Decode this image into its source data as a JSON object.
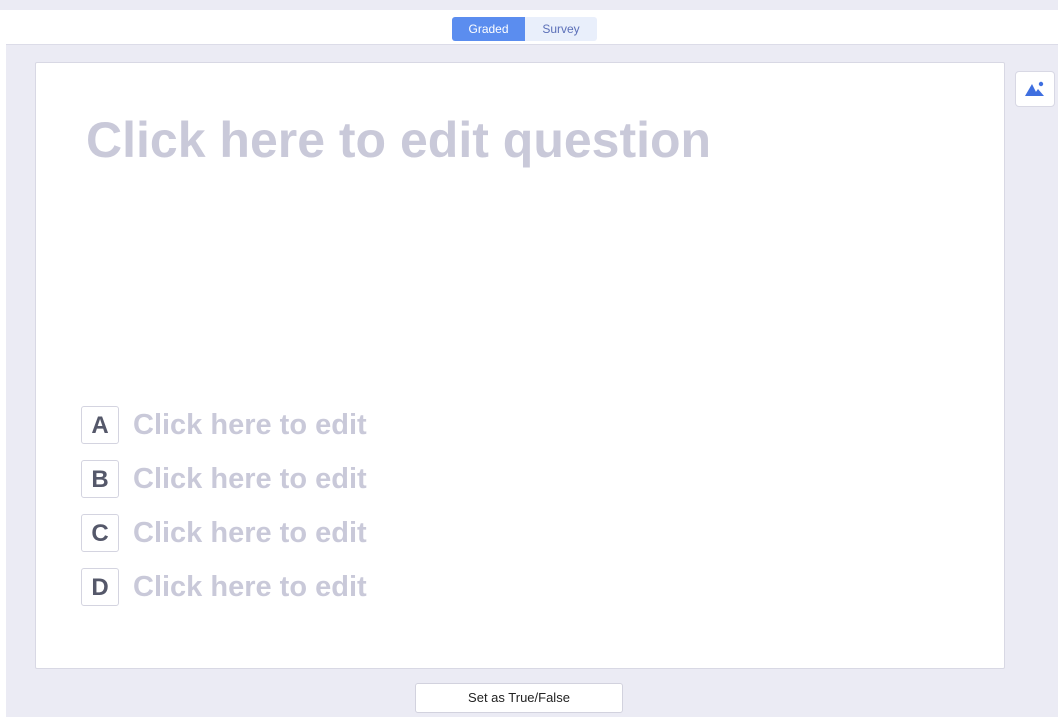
{
  "mode_toggle": {
    "graded_label": "Graded",
    "survey_label": "Survey",
    "selected": "Graded"
  },
  "question": {
    "placeholder": "Click here to edit question"
  },
  "options": [
    {
      "letter": "A",
      "placeholder": "Click here to edit"
    },
    {
      "letter": "B",
      "placeholder": "Click here to edit"
    },
    {
      "letter": "C",
      "placeholder": "Click here to edit"
    },
    {
      "letter": "D",
      "placeholder": "Click here to edit"
    }
  ],
  "image_button": {
    "icon": "image-icon"
  },
  "footer": {
    "true_false_label": "Set as True/False"
  },
  "colors": {
    "accent": "#5b8def",
    "placeholder_text": "#c9c9d9",
    "background": "#ebebf4"
  }
}
